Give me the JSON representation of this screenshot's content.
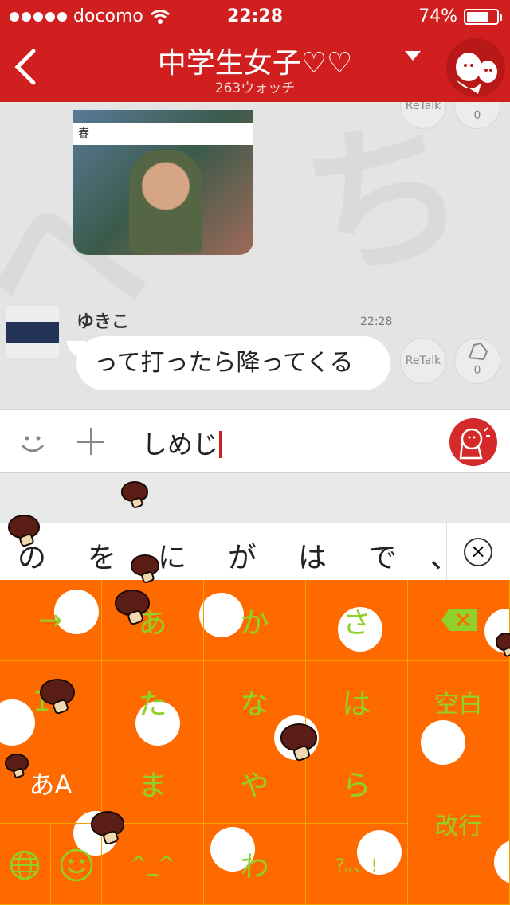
{
  "status_bar": {
    "carrier": "docomo",
    "time": "22:28",
    "battery": "74%",
    "battery_level": 0.74
  },
  "header": {
    "title": "中学生女子♡♡",
    "subtitle": "263ウォッチ"
  },
  "chat": {
    "image_message": {
      "keyboard_label": "春"
    },
    "retalk_label": "ReTalk",
    "clap_count_top": "0",
    "message": {
      "sender": "ゆきこ",
      "time": "22:28",
      "text": "って打ったら降ってくる",
      "clap_count": "0"
    }
  },
  "input": {
    "text": "しめじ"
  },
  "candidates": [
    "の",
    "を",
    "に",
    "が",
    "は",
    "で",
    "、"
  ],
  "keyboard": {
    "rows": [
      [
        "→",
        "あ",
        "か",
        "さ",
        "⌫"
      ],
      [
        "12",
        "た",
        "な",
        "は",
        "空白"
      ],
      [
        "あA",
        "ま",
        "や",
        "ら",
        "改行"
      ],
      [
        "",
        "^_^",
        "わ",
        "?。、!"
      ]
    ],
    "text_color": "#8fd12a",
    "background": "#ff6a00"
  },
  "colors": {
    "header": "#d11f1f",
    "keyboard": "#ff6a00",
    "key_text": "#8fd12a"
  }
}
